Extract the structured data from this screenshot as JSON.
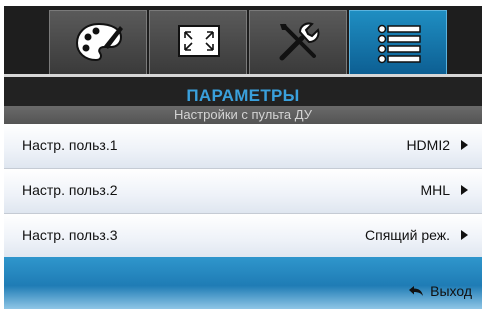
{
  "tabs": [
    {
      "icon": "palette-icon",
      "active": false
    },
    {
      "icon": "screen-resize-icon",
      "active": false
    },
    {
      "icon": "tools-icon",
      "active": false
    },
    {
      "icon": "options-list-icon",
      "active": true
    }
  ],
  "header": {
    "title": "ПАРАМЕТРЫ",
    "subtitle": "Настройки с пульта ДУ"
  },
  "items": [
    {
      "label": "Настр. польз.1",
      "value": "HDMI2"
    },
    {
      "label": "Настр. польз.2",
      "value": "MHL"
    },
    {
      "label": "Настр. польз.3",
      "value": "Спящий реж."
    }
  ],
  "footer": {
    "exit_label": "Выход",
    "exit_icon": "return-arrow-icon"
  },
  "colors": {
    "accent": "#3aa0dc",
    "active_tab": "#1580b8",
    "footer": "#1f7cb5"
  }
}
